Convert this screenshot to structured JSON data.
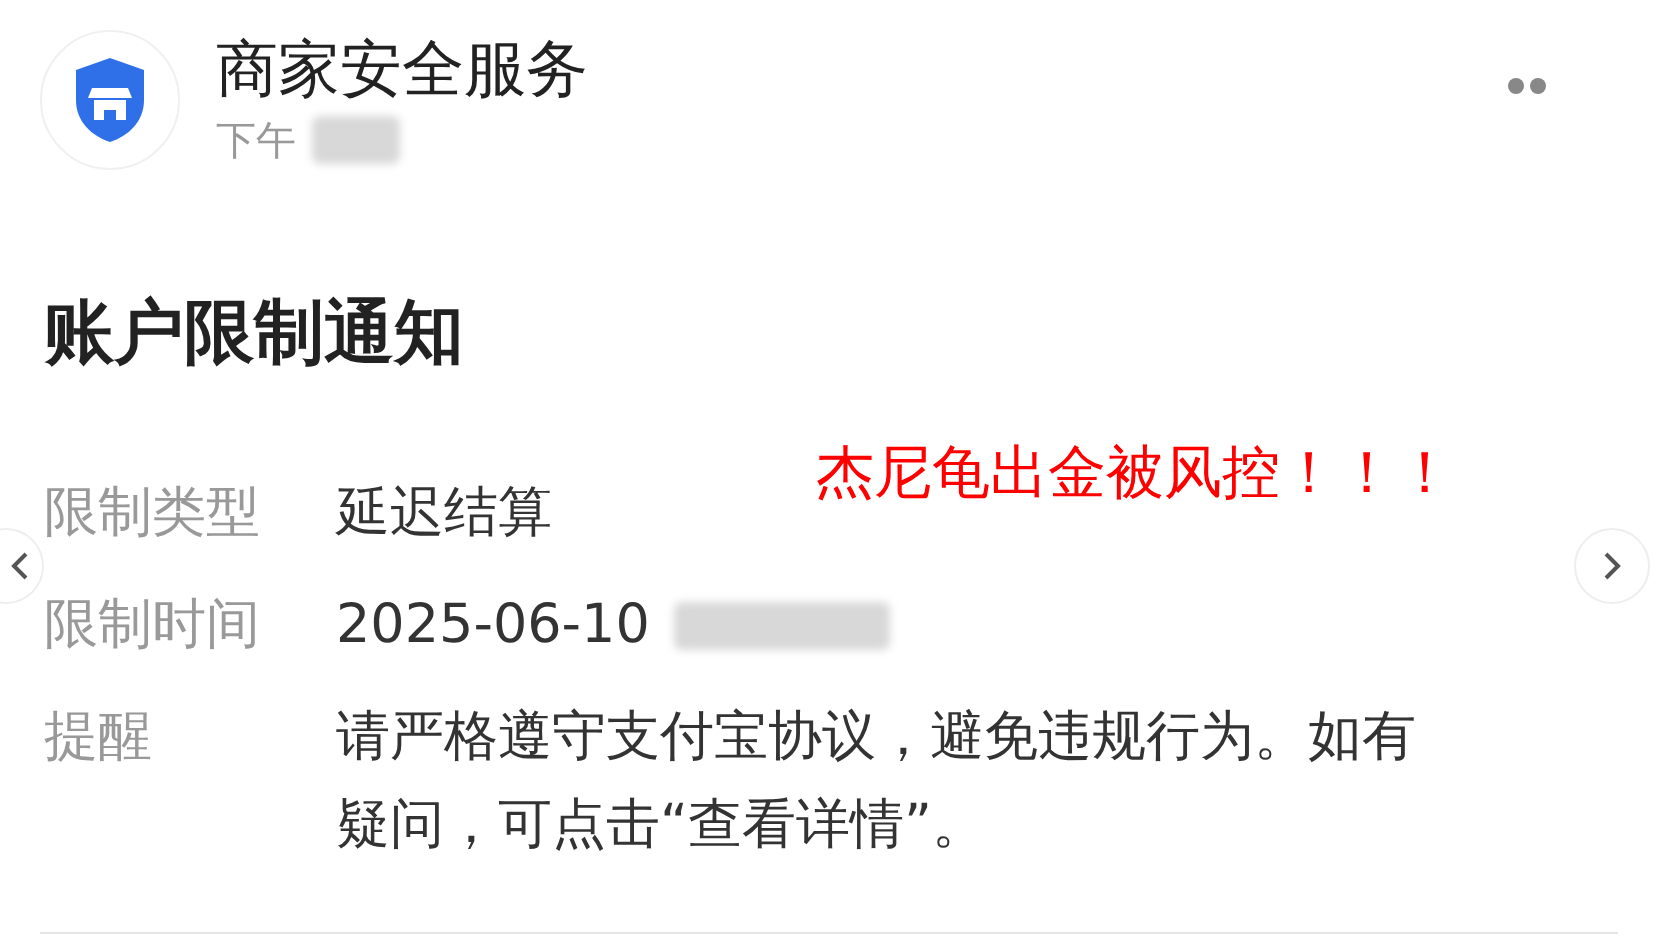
{
  "header": {
    "sender": "商家安全服务",
    "time_prefix": "下午",
    "time_redacted": true
  },
  "notice": {
    "title": "账户限制通知",
    "fields": [
      {
        "label": "限制类型",
        "value": "延迟结算",
        "redacted": false
      },
      {
        "label": "限制时间",
        "value": "2025-06-10",
        "redacted": true
      },
      {
        "label": "提醒",
        "value": "请严格遵守支付宝协议，避免违规行为。如有疑问，可点击“查看详情”。",
        "redacted": false
      }
    ]
  },
  "annotation": "杰尼龟出金被风控！！！"
}
